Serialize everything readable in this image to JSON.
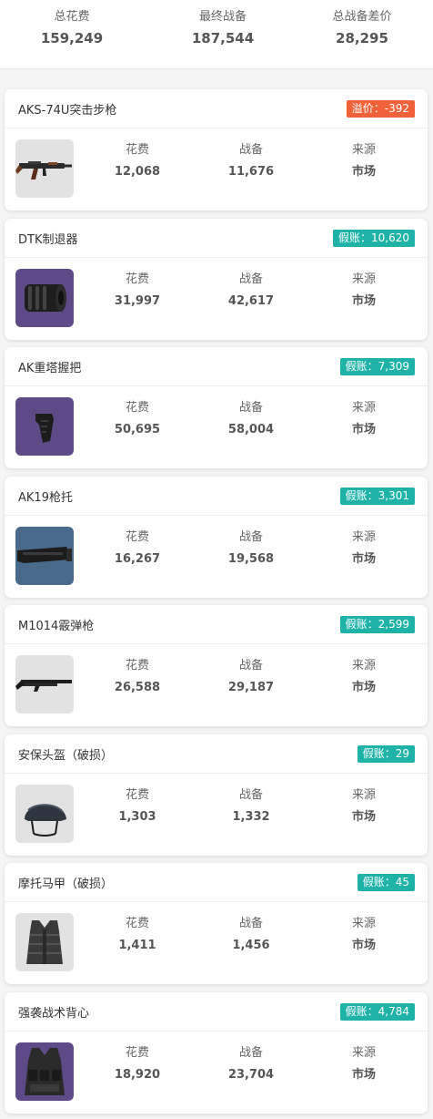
{
  "summary": {
    "total_cost_label": "总花费",
    "total_cost": "159,249",
    "final_value_label": "最终战备",
    "final_value": "187,544",
    "diff_label": "总战备差价",
    "diff": "28,295"
  },
  "colors": {
    "overprice": "#f2623a",
    "bargain": "#1fb3a8"
  },
  "items": [
    {
      "name": "AKS-74U突击步枪",
      "badge": "溢价：-392",
      "badge_type": "overprice",
      "icon": "rifle-icon",
      "thumb_bg": "#e2e2e2",
      "cost_label": "花费",
      "cost": "12,068",
      "value_label": "战备",
      "value": "11,676",
      "source_label": "来源",
      "source": "市场"
    },
    {
      "name": "DTK制退器",
      "badge": "假账：10,620",
      "badge_type": "bargain",
      "icon": "muzzle-brake-icon",
      "thumb_bg": "#5e4a87",
      "cost_label": "花费",
      "cost": "31,997",
      "value_label": "战备",
      "value": "42,617",
      "source_label": "来源",
      "source": "市场"
    },
    {
      "name": "AK重塔握把",
      "badge": "假账：7,309",
      "badge_type": "bargain",
      "icon": "grip-icon",
      "thumb_bg": "#5e4a87",
      "cost_label": "花费",
      "cost": "50,695",
      "value_label": "战备",
      "value": "58,004",
      "source_label": "来源",
      "source": "市场"
    },
    {
      "name": "AK19枪托",
      "badge": "假账：3,301",
      "badge_type": "bargain",
      "icon": "stock-icon",
      "thumb_bg": "#4a6a8c",
      "cost_label": "花费",
      "cost": "16,267",
      "value_label": "战备",
      "value": "19,568",
      "source_label": "来源",
      "source": "市场"
    },
    {
      "name": "M1014霰弹枪",
      "badge": "假账：2,599",
      "badge_type": "bargain",
      "icon": "shotgun-icon",
      "thumb_bg": "#e2e2e2",
      "cost_label": "花费",
      "cost": "26,588",
      "value_label": "战备",
      "value": "29,187",
      "source_label": "来源",
      "source": "市场"
    },
    {
      "name": "安保头盔（破损）",
      "badge": "假账：29",
      "badge_type": "bargain",
      "icon": "helmet-icon",
      "thumb_bg": "#e2e2e2",
      "cost_label": "花费",
      "cost": "1,303",
      "value_label": "战备",
      "value": "1,332",
      "source_label": "来源",
      "source": "市场"
    },
    {
      "name": "摩托马甲（破损）",
      "badge": "假账：45",
      "badge_type": "bargain",
      "icon": "vest-icon",
      "thumb_bg": "#e2e2e2",
      "cost_label": "花费",
      "cost": "1,411",
      "value_label": "战备",
      "value": "1,456",
      "source_label": "来源",
      "source": "市场"
    },
    {
      "name": "强袭战术背心",
      "badge": "假账：4,784",
      "badge_type": "bargain",
      "icon": "tactical-vest-icon",
      "thumb_bg": "#5e4a87",
      "cost_label": "花费",
      "cost": "18,920",
      "value_label": "战备",
      "value": "23,704",
      "source_label": "来源",
      "source": "市场"
    }
  ]
}
